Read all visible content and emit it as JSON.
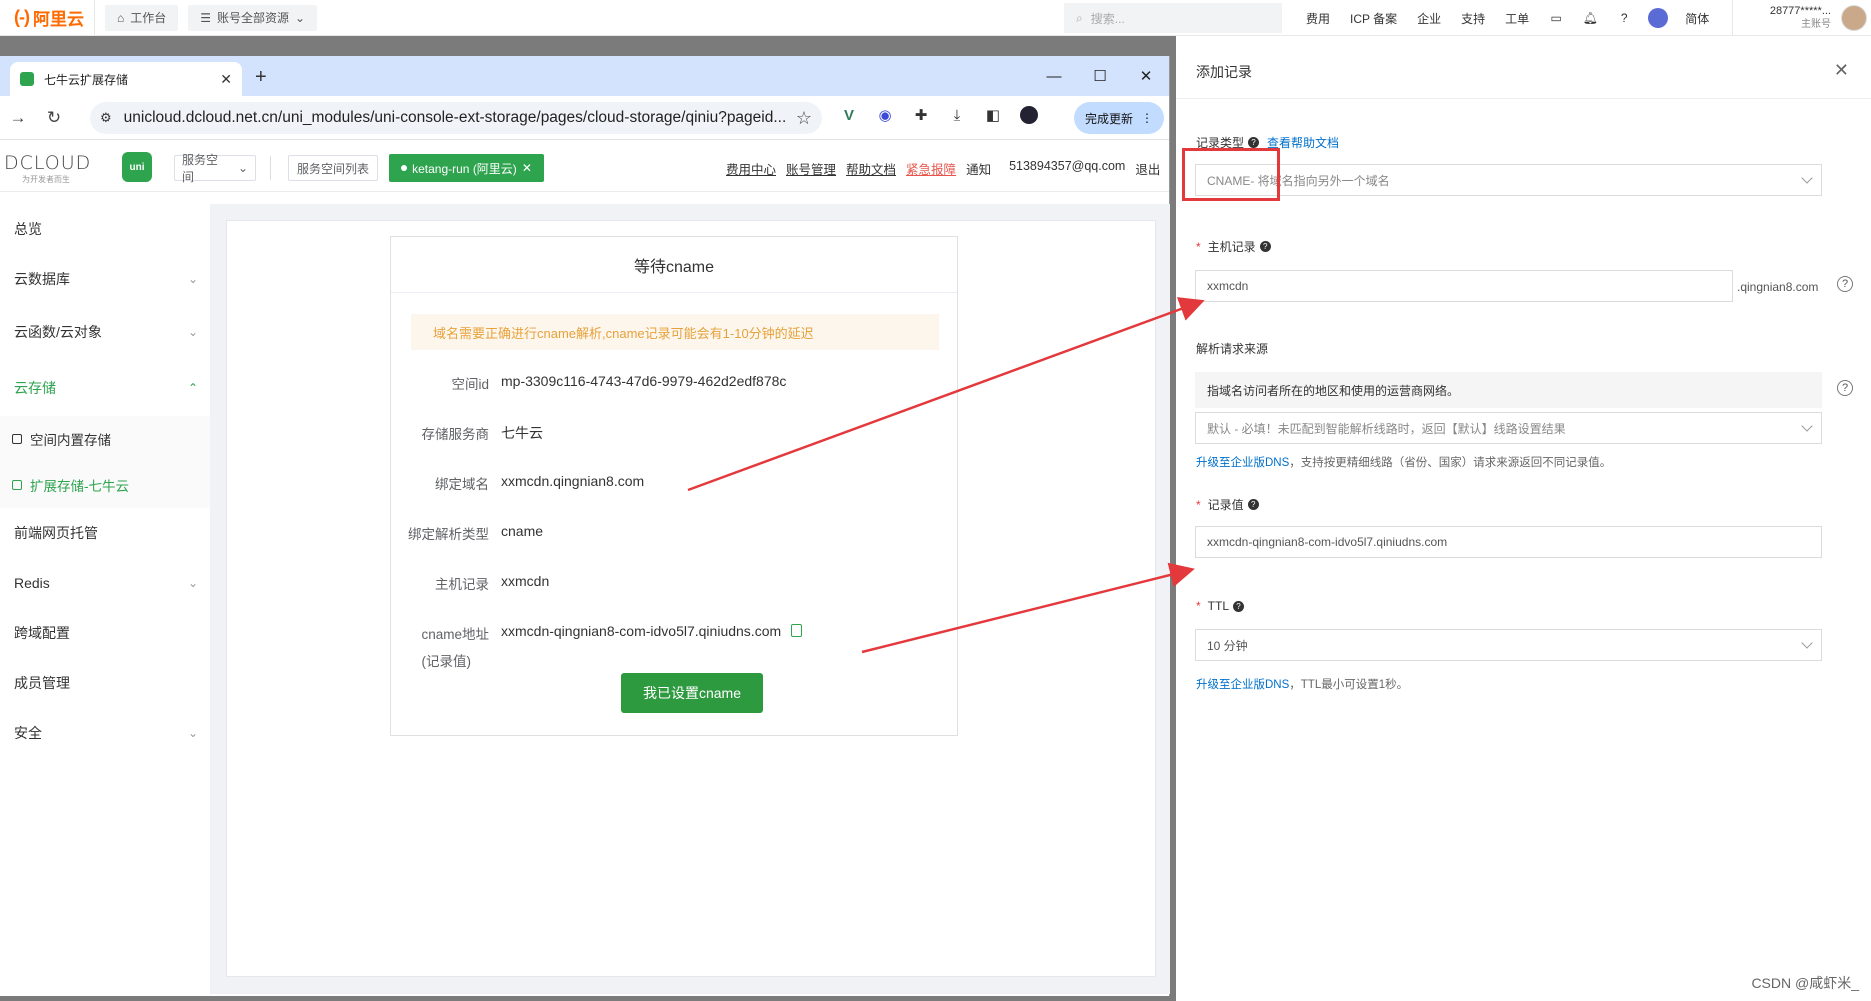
{
  "aliyun": {
    "logo_mark": "(-)",
    "logo_text": "阿里云",
    "workbench": "工作台",
    "resources": "账号全部资源",
    "search_placeholder": "搜索...",
    "links": [
      "费用",
      "ICP 备案",
      "企业",
      "支持",
      "工单"
    ],
    "lang": "简体",
    "user_id": "28777*****...",
    "user_role": "主账号"
  },
  "browser": {
    "tab_title": "七牛云扩展存储",
    "url": "unicloud.dcloud.net.cn/uni_modules/uni-console-ext-storage/pages/cloud-storage/qiniu?pageid...",
    "update_label": "完成更新"
  },
  "dcloud": {
    "logo": "DCLOUD",
    "slogan": "为开发者而生",
    "uni_badge": "uni",
    "service_space": "服务空间",
    "space_list": "服务空间列表",
    "active_space": "ketang-run (阿里云)",
    "nav": {
      "billing": "费用中心",
      "account": "账号管理",
      "docs": "帮助文档",
      "report": "紧急报障",
      "notice": "通知",
      "email": "513894357@qq.com",
      "logout": "退出"
    }
  },
  "sidebar": {
    "items": [
      {
        "label": "总览"
      },
      {
        "label": "云数据库"
      },
      {
        "label": "云函数/云对象"
      },
      {
        "label": "云存储"
      },
      {
        "label": "空间内置存储"
      },
      {
        "label": "扩展存储-七牛云"
      },
      {
        "label": "前端网页托管"
      },
      {
        "label": "Redis"
      },
      {
        "label": "跨域配置"
      },
      {
        "label": "成员管理"
      },
      {
        "label": "安全"
      }
    ]
  },
  "dialog": {
    "title": "等待cname",
    "alert": "域名需要正确进行cname解析,cname记录可能会有1-10分钟的延迟",
    "rows": [
      {
        "label": "空间id",
        "value": "mp-3309c116-4743-47d6-9979-462d2edf878c"
      },
      {
        "label": "存储服务商",
        "value": "七牛云"
      },
      {
        "label": "绑定域名",
        "value": "xxmcdn.qingnian8.com"
      },
      {
        "label": "绑定解析类型",
        "value": "cname"
      },
      {
        "label": "主机记录",
        "value": "xxmcdn"
      },
      {
        "label": "cname地址",
        "value": "xxmcdn-qingnian8-com-idvo5l7.qiniudns.com"
      }
    ],
    "cname_sub": "(记录值)",
    "confirm_button": "我已设置cname"
  },
  "drawer": {
    "title": "添加记录",
    "record_type_label": "记录类型",
    "help_doc": "查看帮助文档",
    "record_type_value": "CNAME- 将域名指向另外一个域名",
    "host_label": "主机记录",
    "host_value": "xxmcdn",
    "host_suffix": ".qingnian8.com",
    "source_label": "解析请求来源",
    "source_info": "指域名访问者所在的地区和使用的运营商网络。",
    "source_value": "默认 - 必填！未匹配到智能解析线路时，返回【默认】线路设置结果",
    "upgrade_link": "升级至企业版DNS",
    "upgrade_text_1": "，支持按更精细线路（省份、国家）请求来源返回不同记录值。",
    "value_label": "记录值",
    "value_value": "xxmcdn-qingnian8-com-idvo5l7.qiniudns.com",
    "ttl_label": "TTL",
    "ttl_value": "10 分钟",
    "upgrade_text_2": "，TTL最小可设置1秒。"
  },
  "watermark": "CSDN @咸虾米_",
  "colors": {
    "aliyun_orange": "#ff6a00",
    "dcloud_green": "#2ea44f",
    "annotation_red": "#e4393c",
    "link_blue": "#0070cc"
  }
}
